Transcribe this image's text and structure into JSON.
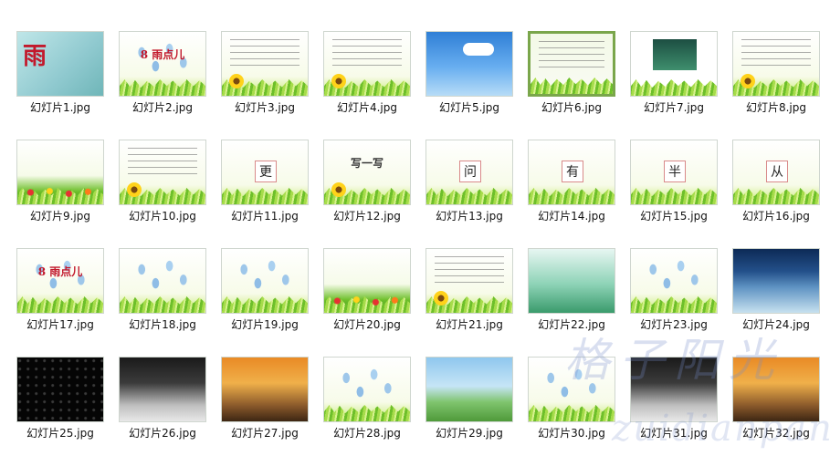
{
  "files": [
    {
      "name": "幻灯片1.jpg",
      "thumb_text": "雨",
      "theme": "cover"
    },
    {
      "name": "幻灯片2.jpg",
      "thumb_text": "8 雨点儿",
      "theme": "blue-drops"
    },
    {
      "name": "幻灯片3.jpg",
      "thumb_text": "",
      "theme": "lines"
    },
    {
      "name": "幻灯片4.jpg",
      "thumb_text": "",
      "theme": "lines"
    },
    {
      "name": "幻灯片5.jpg",
      "thumb_text": "",
      "theme": "sky"
    },
    {
      "name": "幻灯片6.jpg",
      "thumb_text": "",
      "theme": "chalk"
    },
    {
      "name": "幻灯片7.jpg",
      "thumb_text": "",
      "theme": "teal"
    },
    {
      "name": "幻灯片8.jpg",
      "thumb_text": "",
      "theme": "lines"
    },
    {
      "name": "幻灯片9.jpg",
      "thumb_text": "",
      "theme": "flowers"
    },
    {
      "name": "幻灯片10.jpg",
      "thumb_text": "",
      "theme": "lines"
    },
    {
      "name": "幻灯片11.jpg",
      "thumb_text": "更",
      "theme": "charbox"
    },
    {
      "name": "幻灯片12.jpg",
      "thumb_text": "写一写",
      "theme": "plain"
    },
    {
      "name": "幻灯片13.jpg",
      "thumb_text": "问",
      "theme": "charbox"
    },
    {
      "name": "幻灯片14.jpg",
      "thumb_text": "有",
      "theme": "charbox"
    },
    {
      "name": "幻灯片15.jpg",
      "thumb_text": "半",
      "theme": "charbox"
    },
    {
      "name": "幻灯片16.jpg",
      "thumb_text": "从",
      "theme": "charbox"
    },
    {
      "name": "幻灯片17.jpg",
      "thumb_text": "8 雨点儿",
      "theme": "blue-drops"
    },
    {
      "name": "幻灯片18.jpg",
      "thumb_text": "",
      "theme": "blue-drops"
    },
    {
      "name": "幻灯片19.jpg",
      "thumb_text": "",
      "theme": "blue-drops"
    },
    {
      "name": "幻灯片20.jpg",
      "thumb_text": "",
      "theme": "flowers"
    },
    {
      "name": "幻灯片21.jpg",
      "thumb_text": "",
      "theme": "lines"
    },
    {
      "name": "幻灯片22.jpg",
      "thumb_text": "",
      "theme": "lotus"
    },
    {
      "name": "幻灯片23.jpg",
      "thumb_text": "",
      "theme": "blue-drops"
    },
    {
      "name": "幻灯片24.jpg",
      "thumb_text": "",
      "theme": "wave"
    },
    {
      "name": "幻灯片25.jpg",
      "thumb_text": "",
      "theme": "night"
    },
    {
      "name": "幻灯片26.jpg",
      "thumb_text": "",
      "theme": "snow"
    },
    {
      "name": "幻灯片27.jpg",
      "thumb_text": "",
      "theme": "autumn"
    },
    {
      "name": "幻灯片28.jpg",
      "thumb_text": "",
      "theme": "blue-drops"
    },
    {
      "name": "幻灯片29.jpg",
      "thumb_text": "",
      "theme": "dandelion"
    },
    {
      "name": "幻灯片30.jpg",
      "thumb_text": "",
      "theme": "blue-drops"
    },
    {
      "name": "幻灯片31.jpg",
      "thumb_text": "",
      "theme": "snow"
    },
    {
      "name": "幻灯片32.jpg",
      "thumb_text": "",
      "theme": "autumn"
    }
  ],
  "watermark": {
    "cn": "格子阳光",
    "en": "zuidianpan"
  }
}
